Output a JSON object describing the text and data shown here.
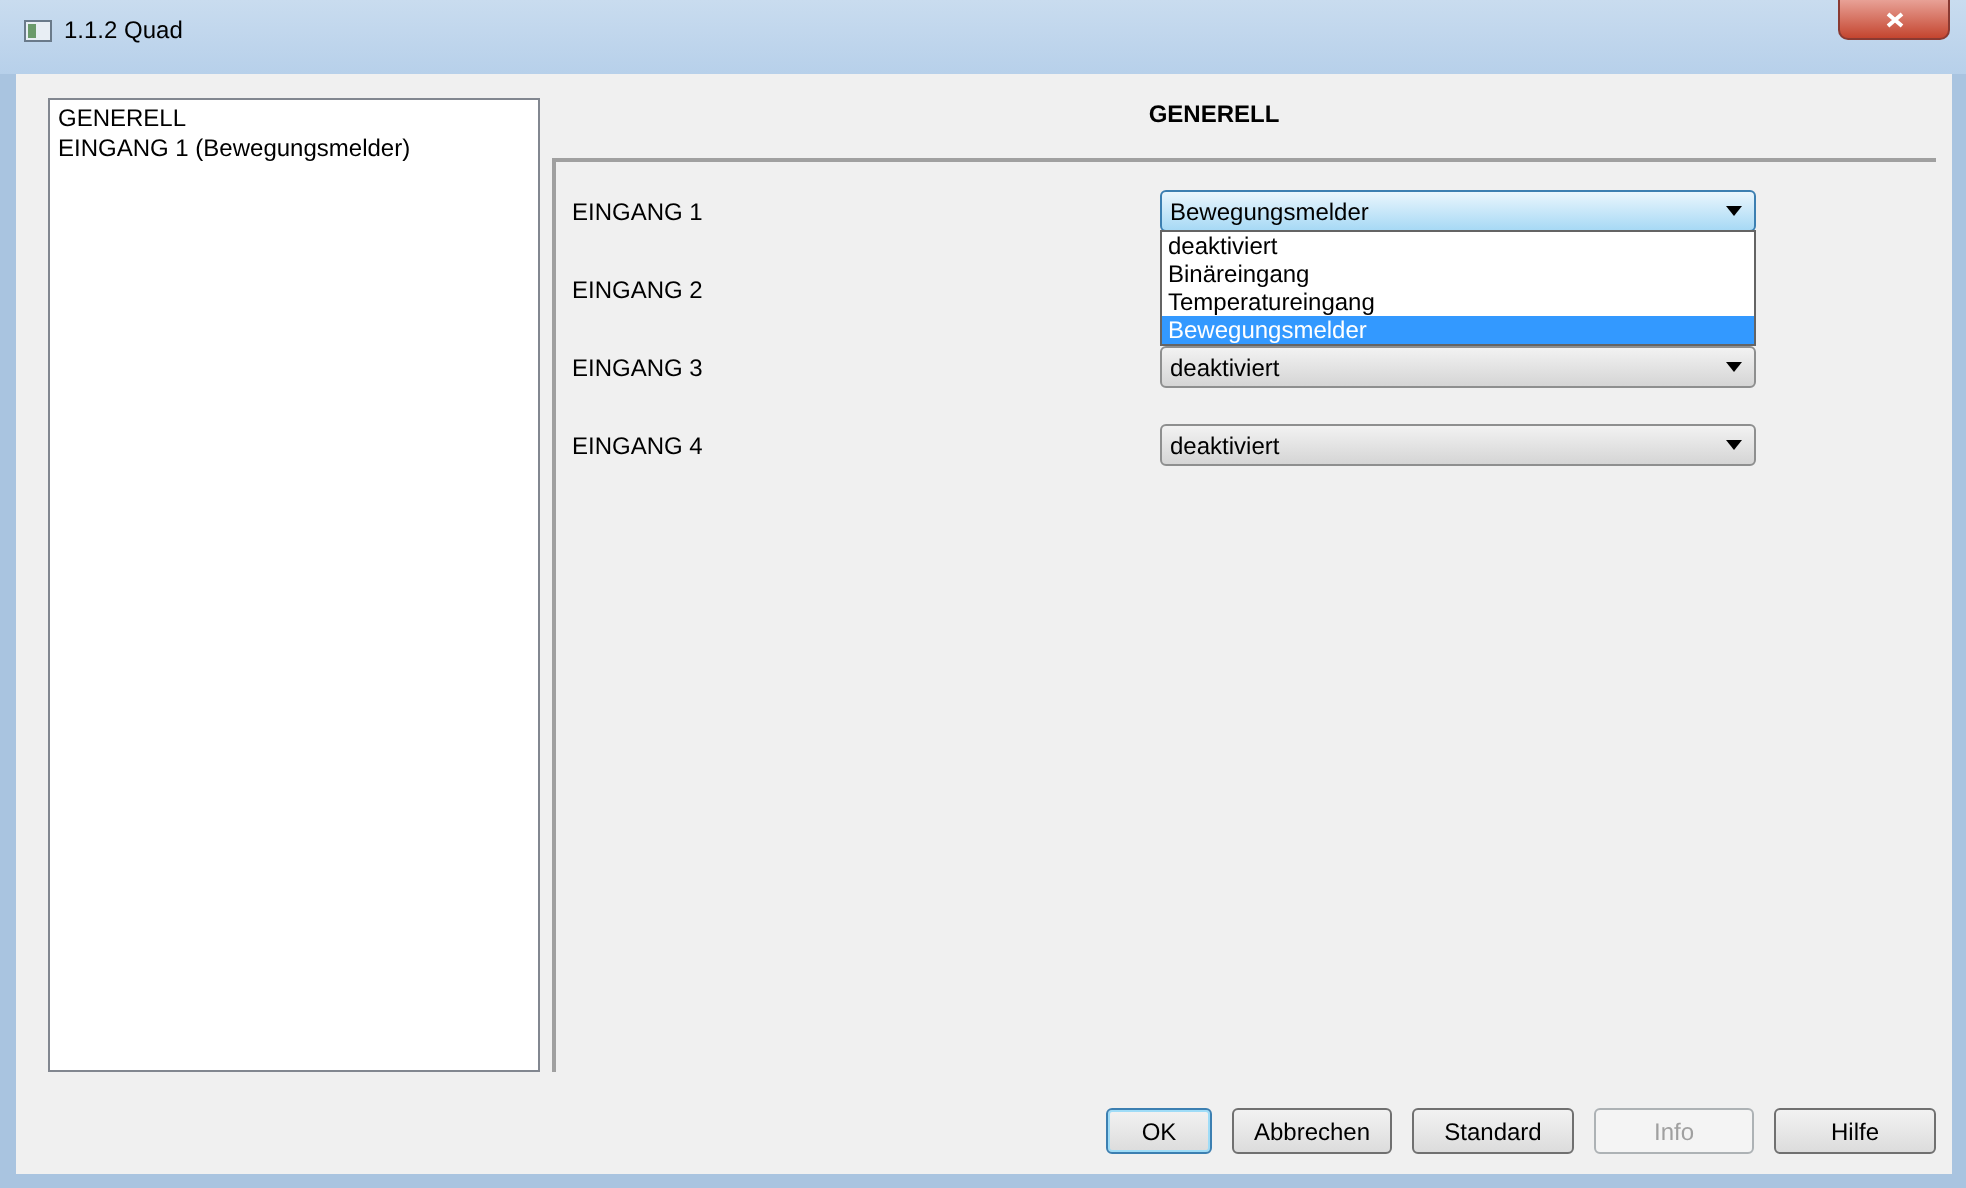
{
  "window": {
    "title": "1.1.2 Quad"
  },
  "sidebar": {
    "items": [
      "GENERELL",
      "EINGANG 1 (Bewegungsmelder)"
    ]
  },
  "page": {
    "heading": "GENERELL",
    "rows": [
      {
        "label": "EINGANG 1",
        "value": "Bewegungsmelder",
        "open": true,
        "options": [
          {
            "label": "deaktiviert",
            "selected": false
          },
          {
            "label": "Binäreingang",
            "selected": false
          },
          {
            "label": "Temperatureingang",
            "selected": false
          },
          {
            "label": "Bewegungsmelder",
            "selected": true
          }
        ]
      },
      {
        "label": "EINGANG 2"
      },
      {
        "label": "EINGANG 3",
        "value": "deaktiviert",
        "open": false
      },
      {
        "label": "EINGANG 4",
        "value": "deaktiviert",
        "open": false
      }
    ]
  },
  "buttons": [
    {
      "label": "OK",
      "disabled": false,
      "default": true
    },
    {
      "label": "Abbrechen",
      "disabled": false,
      "default": false
    },
    {
      "label": "Standard",
      "disabled": false,
      "default": false
    },
    {
      "label": "Info",
      "disabled": true,
      "default": false
    },
    {
      "label": "Hilfe",
      "disabled": false,
      "default": false
    }
  ]
}
